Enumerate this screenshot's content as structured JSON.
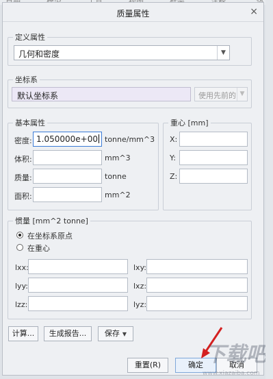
{
  "background_bar": {
    "items": [
      "日期",
      "模型",
      "工具",
      "视图",
      "框架",
      "注释",
      "体"
    ]
  },
  "dialog": {
    "title": "质量属性",
    "close_label": "×",
    "define_attr": {
      "legend": "定义属性",
      "selected": "几何和密度"
    },
    "coord_sys": {
      "legend": "坐标系",
      "value": "默认坐标系",
      "use_prev_label": "使用先前的"
    },
    "basic_props": {
      "legend": "基本属性",
      "density": {
        "label": "密度:",
        "value": "1.050000e+00",
        "unit": "tonne/mm^3"
      },
      "volume": {
        "label": "体积:",
        "value": "",
        "unit": "mm^3"
      },
      "mass": {
        "label": "质量:",
        "value": "",
        "unit": "tonne"
      },
      "area": {
        "label": "面积:",
        "value": "",
        "unit": "mm^2"
      }
    },
    "centroid": {
      "legend": "重心 [mm]",
      "x_label": "X:",
      "y_label": "Y:",
      "z_label": "Z:"
    },
    "inertia": {
      "legend": "惯量 [mm^2 tonne]",
      "radio1": "在坐标系原点",
      "radio2": "在重心",
      "selected": "在坐标系原点",
      "lxx": "lxx:",
      "lxy": "lxy:",
      "lyy": "lyy:",
      "lxz": "lxz:",
      "lzz": "lzz:",
      "lyz": "lyz:"
    },
    "buttons": {
      "compute": "计算...",
      "report": "生成报告...",
      "save": "保存",
      "reset": "重置(R)",
      "ok": "确定",
      "cancel": "取消"
    }
  },
  "watermark": "下载吧",
  "watermark_url": "www.xiazaiba.com"
}
